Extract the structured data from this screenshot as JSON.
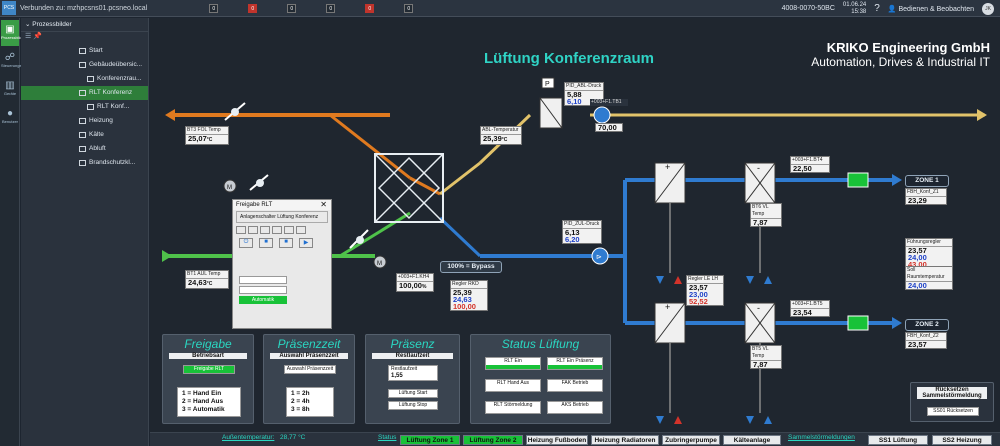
{
  "topbar": {
    "connection": "Verbunden zu: mzhpcsns01.pcsneo.local",
    "alarm_counts": [
      "0",
      "0",
      "0",
      "0",
      "0",
      "0"
    ],
    "device_id": "4008-0070-50BC",
    "date": "01.06.24",
    "time": "15:38",
    "mode": "Bedienen & Beobachten",
    "user_initials": "JK"
  },
  "rail": [
    {
      "label": "Prozessbilder",
      "icon": "image-icon"
    },
    {
      "label": "Steuerungen",
      "icon": "sitemap-icon"
    },
    {
      "label": "Geräte",
      "icon": "columns-icon"
    },
    {
      "label": "Benutzer",
      "icon": "user-icon"
    }
  ],
  "tree": {
    "title": "Prozessbilder",
    "nodes": [
      {
        "label": "Start",
        "indent": 0
      },
      {
        "label": "Gebäudeübersic...",
        "indent": 0
      },
      {
        "label": "Konferenzrau...",
        "indent": 1
      },
      {
        "label": "RLT Konferenz",
        "indent": 0,
        "selected": true
      },
      {
        "label": "RLT Konf...",
        "indent": 1
      },
      {
        "label": "Heizung",
        "indent": 0
      },
      {
        "label": "Kälte",
        "indent": 0
      },
      {
        "label": "Abluft",
        "indent": 0
      },
      {
        "label": "Brandschutzkl...",
        "indent": 0
      }
    ]
  },
  "scada": {
    "title": "Lüftung Konferenzraum",
    "brand_line1": "KRIKO Engineering GmbH",
    "brand_line2": "Automation, Drives & Industrial IT",
    "values": {
      "fol_temp": {
        "tag": "BT3 FOL Temp",
        "value": "25,07",
        "unit": "°C"
      },
      "abl_druck": {
        "tag": "PID_ABL-Druck",
        "v1": "5,88",
        "v2": "6,10"
      },
      "abl_temp": {
        "tag": "ABL-Temperatur",
        "value": "25,39",
        "unit": "°C"
      },
      "fan_abl": {
        "tag": "+003+F1.TB1",
        "value": "70,00"
      },
      "aul_temp": {
        "tag": "BT1 AUL Temp",
        "value": "24,63",
        "unit": "°C"
      },
      "zul_druck": {
        "tag": "PID_ZUL-Druck",
        "v1": "6,13",
        "v2": "6,20"
      },
      "fan_zul": {
        "tag": "+003+F1.TB1",
        "value": "0"
      },
      "bypass_label": "100% = Bypass",
      "damper": {
        "tag": "+003+F1.KH4",
        "value": "100,00",
        "unit": "%"
      },
      "regler_rkd": {
        "tag": "Regler RKD",
        "v1": "25,39",
        "v2": "24,63",
        "v3": "100,00"
      },
      "regler_le": {
        "tag": "Regler LE LH",
        "v1": "23,57",
        "v2": "23,00",
        "v3": "52,52"
      },
      "bt6_temp": {
        "tag": "BT6 VL Temp",
        "value": "7,87"
      },
      "bt5_temp": {
        "tag": "BT5 VL Temp",
        "value": "7,87"
      },
      "z1_temp": {
        "tag": "+003+F1.BT4",
        "value": "22,50"
      },
      "z2_temp": {
        "tag": "+003+F1.BT5",
        "value": "23,54"
      },
      "fbh_z1": {
        "tag": "FBH_Konf_Z1",
        "value": "23,29"
      },
      "fbh_z2": {
        "tag": "FBH_Konf_Z2",
        "value": "23,57"
      },
      "fuehrung": {
        "tag": "Führungsregler",
        "v1": "23,57",
        "v2": "24,00",
        "v3": "43,00"
      },
      "soll_raum": {
        "tag": "Soll Raumtemperatur",
        "value": "24,00"
      },
      "zone1": "ZONE 1",
      "zone2": "ZONE 2"
    }
  },
  "dialog": {
    "title": "Freigabe RLT",
    "subtitle": "Anlagenschalter Lüftung Konferenz",
    "button": "Automatik"
  },
  "panels": {
    "freigabe": {
      "title": "Freigabe",
      "sub": "Betriebsart",
      "value": "Freigabe RLT",
      "legend": [
        "1 = Hand Ein",
        "2 = Hand Aus",
        "3 = Automatik"
      ]
    },
    "praesenzzeit": {
      "title": "Präsenzzeit",
      "sub": "Auswahl Präsenzzeit",
      "value": "Auswahl Präsenzzeit",
      "legend": [
        "1 = 2h",
        "2 = 4h",
        "3 = 8h"
      ]
    },
    "praesenz": {
      "title": "Präsenz",
      "sub": "Restlaufzeit",
      "value": "1,55",
      "rows": [
        "Restlaufzeit",
        "Lüftung Start",
        "Lüftung Stop"
      ]
    },
    "status": {
      "title": "Status Lüftung",
      "rows": [
        "RLT Ein",
        "RLT Ein Präsenz",
        "RLT Hand Aus",
        "FAK Betrieb",
        "RLT Störmeldung",
        "AKS Betrieb"
      ]
    },
    "reset": {
      "title": "Rücksetzen Sammelstörmeldung",
      "field": "SS01 Rücksetzen"
    }
  },
  "bottombar": {
    "outdoor_label": "Außentemperatur:",
    "outdoor_value": "28,77 °C",
    "status_label": "Status",
    "buttons": [
      "Lüftung Zone 1",
      "Lüftung Zone 2",
      "Heizung Fußboden",
      "Heizung Radiatoren",
      "Zubringerpumpe",
      "Kälteanlage"
    ],
    "alarm_label": "Sammelstörmeldungen",
    "alarm_buttons": [
      "SS1 Lüftung",
      "SS2 Heizung"
    ]
  },
  "colors": {
    "accent": "#2ad7c2",
    "green": "#18c238",
    "abluft": "#e07a1f",
    "zuluft": "#2f7bd0",
    "fortluft": "#e2c36a",
    "aussenluft": "#4fc24a"
  }
}
